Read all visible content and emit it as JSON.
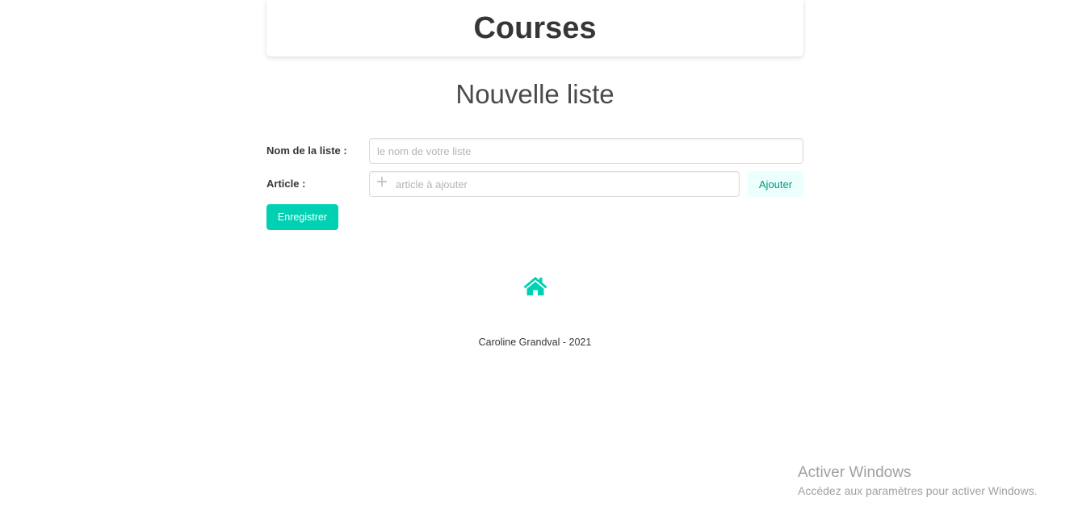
{
  "header": {
    "title": "Courses"
  },
  "main": {
    "subtitle": "Nouvelle liste"
  },
  "form": {
    "list_name": {
      "label": "Nom de la liste :",
      "value": "",
      "placeholder": "le nom de votre liste"
    },
    "article": {
      "label": "Article :",
      "value": "",
      "placeholder": "article à ajouter",
      "icon": "plus-icon"
    },
    "add_label": "Ajouter",
    "save_label": "Enregistrer"
  },
  "nav": {
    "home_icon": "home-icon"
  },
  "footer": {
    "text": "Caroline Grandval - 2021"
  },
  "os_watermark": {
    "title": "Activer Windows",
    "subtitle": "Accédez aux paramètres pour activer Windows."
  },
  "colors": {
    "accent": "#00d1b2",
    "accent_light": "#ebfffc",
    "accent_dark": "#00947e",
    "text": "#363636"
  }
}
